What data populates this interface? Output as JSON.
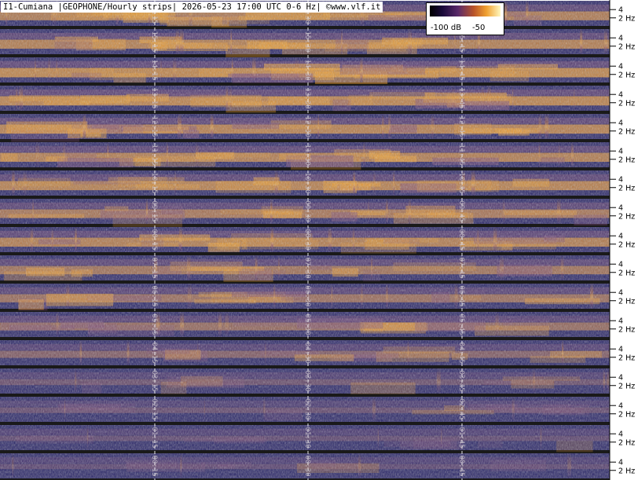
{
  "header": {
    "title": "I1-Cumiana |GEOPHONE/Hourly strips| 2026-05-23 17:00 UTC 0-6 Hz| ©www.vlf.it"
  },
  "colors": {
    "low": "#262266",
    "mid": "#7a4a78",
    "high": "#f0a030",
    "peak": "#fff0a0",
    "gap": "#1a1a1a",
    "grid": "#ffffff"
  },
  "scale": {
    "label_low": "-100 dB",
    "label_high": "-50",
    "db_min": -110,
    "db_max": -40
  },
  "chart_data": {
    "type": "heatmap",
    "title": "I1-Cumiana |GEOPHONE/Hourly strips| 2026-05-23 17:00 UTC 0-6 Hz| ©www.vlf.it",
    "y_freq_range_hz": [
      0,
      6
    ],
    "y_tick_labels": [
      "4",
      "2 Hz"
    ],
    "strips": [
      {
        "hour": 16,
        "time_labels": [
          "16:15",
          "16:30"
        ],
        "intensity": 0.7
      },
      {
        "hour": 15,
        "time_labels": [
          "15:15",
          "15:30",
          "15:45"
        ],
        "intensity": 0.72
      },
      {
        "hour": 14,
        "time_labels": [
          "14:15",
          "14:30",
          "14:45"
        ],
        "intensity": 0.78
      },
      {
        "hour": 13,
        "time_labels": [
          "13:15",
          "13:30",
          "13:45"
        ],
        "intensity": 0.76
      },
      {
        "hour": 12,
        "time_labels": [
          "12:15",
          "12:30",
          "12:45"
        ],
        "intensity": 0.74
      },
      {
        "hour": 11,
        "time_labels": [
          "11:15",
          "11:30",
          "11:45"
        ],
        "intensity": 0.72
      },
      {
        "hour": 10,
        "time_labels": [
          "10:15",
          "10:30",
          "10:45"
        ],
        "intensity": 0.74
      },
      {
        "hour": 9,
        "time_labels": [
          "09:15",
          "09:30",
          "09:45"
        ],
        "intensity": 0.66
      },
      {
        "hour": 8,
        "time_labels": [
          "08:15",
          "08:30",
          "08:45"
        ],
        "intensity": 0.72
      },
      {
        "hour": 7,
        "time_labels": [
          "07:15",
          "07:30",
          "07:45"
        ],
        "intensity": 0.62
      },
      {
        "hour": 6,
        "time_labels": [
          "06:15",
          "06:30",
          "06:45"
        ],
        "intensity": 0.58
      },
      {
        "hour": 5,
        "time_labels": [
          "05:15",
          "05:30",
          "05:45"
        ],
        "intensity": 0.55
      },
      {
        "hour": 4,
        "time_labels": [
          "04:15",
          "04:30",
          "04:45"
        ],
        "intensity": 0.42
      },
      {
        "hour": 3,
        "time_labels": [
          "03:15",
          "03:30",
          "03:45"
        ],
        "intensity": 0.25
      },
      {
        "hour": 2,
        "time_labels": [
          "02:15",
          "02:30",
          "02:45"
        ],
        "intensity": 0.2
      },
      {
        "hour": 1,
        "time_labels": [
          "01:15",
          "01:30",
          "01:45"
        ],
        "intensity": 0.15
      },
      {
        "hour": 0,
        "time_labels": [
          "00:15",
          "00:30",
          "00:45"
        ],
        "intensity": 0.12
      }
    ]
  }
}
